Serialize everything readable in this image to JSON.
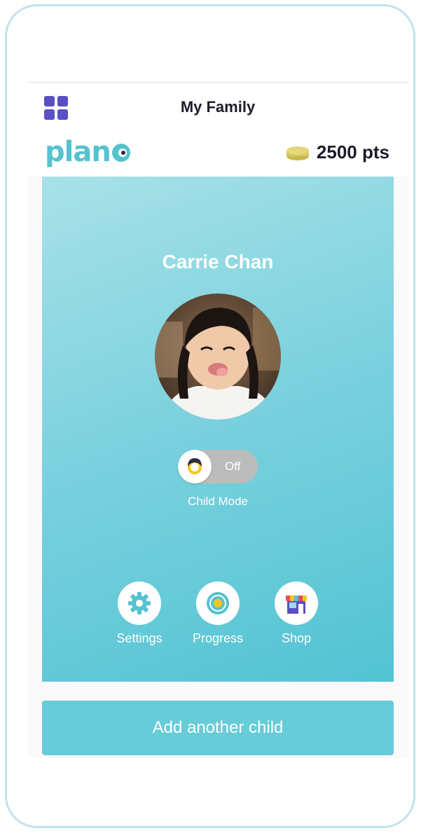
{
  "header": {
    "title": "My Family",
    "menu_icon": "grid-menu-icon"
  },
  "brand": {
    "logo_text": "plan",
    "logo_color": "#56c2cf"
  },
  "points": {
    "value": "2500 pts",
    "icon": "coin-stack-icon"
  },
  "child": {
    "name": "Carrie Chan",
    "photo_alt": "child-photo"
  },
  "child_mode": {
    "state": "Off",
    "label": "Child Mode"
  },
  "actions": [
    {
      "label": "Settings",
      "icon": "gear-icon"
    },
    {
      "label": "Progress",
      "icon": "target-icon"
    },
    {
      "label": "Shop",
      "icon": "shop-icon"
    }
  ],
  "add_child": {
    "label": "Add another child"
  },
  "colors": {
    "accent": "#56c2cf",
    "menu_icon": "#5a4fc4",
    "card_top": "#a8e1e8",
    "card_bottom": "#52c3d3"
  }
}
